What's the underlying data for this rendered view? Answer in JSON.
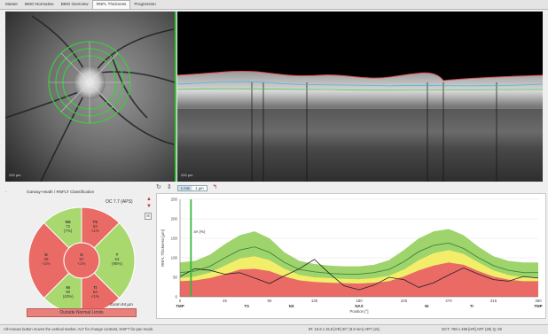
{
  "tabs": [
    {
      "label": "Master",
      "active": false
    },
    {
      "label": "BMO Normative",
      "active": false
    },
    {
      "label": "BMO Overview",
      "active": false
    },
    {
      "label": "RNFL Thickness",
      "active": true
    },
    {
      "label": "Progression",
      "active": false
    }
  ],
  "fundus": {
    "scale_label": "200 µm"
  },
  "oct": {
    "scale_label": "200 µm"
  },
  "toolbar": {
    "toggle_options": [
      "1 mm",
      "1 µm"
    ],
    "selected_toggle": "1 mm"
  },
  "classification": {
    "title": "Garway-Heath / RNFLT Classification",
    "scan_id": "OC 7.7 (APS)",
    "zoom_label": "Zoom 84 µm",
    "result_label": "Outside Normal Limits",
    "sectors": [
      {
        "key": "NS",
        "name": "NS",
        "value": "72",
        "pct": "(7%)",
        "status": "normal"
      },
      {
        "key": "TS",
        "name": "TS",
        "value": "53",
        "pct": "<1%",
        "status": "abnormal"
      },
      {
        "key": "T",
        "name": "T",
        "value": "63",
        "pct": "(95%)",
        "status": "normal"
      },
      {
        "key": "TI",
        "name": "TI",
        "value": "64",
        "pct": "<1%",
        "status": "abnormal"
      },
      {
        "key": "NI",
        "name": "NI",
        "value": "90",
        "pct": "(42%)",
        "status": "normal"
      },
      {
        "key": "N",
        "name": "N",
        "value": "39",
        "pct": "<1%",
        "status": "abnormal"
      },
      {
        "key": "G",
        "name": "G",
        "value": "57",
        "pct": "<1%",
        "status": "abnormal"
      }
    ]
  },
  "chart_data": {
    "type": "area",
    "ylabel": "RNFL Thickness [µm]",
    "xlabel": "Position [°]",
    "xlim": [
      0,
      360
    ],
    "ylim": [
      0,
      250
    ],
    "x_ticks": [
      0,
      45,
      90,
      135,
      180,
      225,
      270,
      315,
      360
    ],
    "y_ticks": [
      0,
      50,
      100,
      150,
      200,
      250
    ],
    "sector_labels": [
      {
        "label": "TMP",
        "x": 0
      },
      {
        "label": "TS",
        "x": 67
      },
      {
        "label": "NS",
        "x": 112
      },
      {
        "label": "NAS",
        "x": 180
      },
      {
        "label": "NI",
        "x": 248
      },
      {
        "label": "TI",
        "x": 293
      },
      {
        "label": "TMP",
        "x": 360
      }
    ],
    "cursor": {
      "x": 11,
      "label": "4A (%)"
    },
    "x": [
      0,
      15,
      30,
      45,
      60,
      75,
      90,
      105,
      120,
      135,
      150,
      165,
      180,
      195,
      210,
      225,
      240,
      255,
      270,
      285,
      300,
      315,
      330,
      345,
      360
    ],
    "band_red_upper": [
      40,
      42,
      48,
      58,
      70,
      72,
      66,
      52,
      42,
      38,
      36,
      35,
      34,
      36,
      40,
      52,
      68,
      80,
      88,
      82,
      66,
      52,
      44,
      40,
      40
    ],
    "band_yellow_upper": [
      48,
      52,
      62,
      80,
      98,
      104,
      94,
      72,
      56,
      50,
      48,
      46,
      45,
      48,
      54,
      70,
      94,
      112,
      120,
      110,
      88,
      68,
      56,
      50,
      48
    ],
    "band_green_upper": [
      88,
      92,
      108,
      135,
      158,
      168,
      150,
      114,
      92,
      84,
      80,
      78,
      78,
      82,
      94,
      120,
      150,
      168,
      174,
      158,
      128,
      104,
      92,
      88,
      88
    ],
    "series": [
      {
        "name": "Normal mean",
        "values": [
          62,
          66,
          78,
          100,
          120,
          128,
          114,
          88,
          70,
          64,
          60,
          58,
          58,
          62,
          70,
          90,
          116,
          132,
          138,
          124,
          100,
          80,
          68,
          62,
          62
        ]
      },
      {
        "name": "Patient",
        "values": [
          52,
          72,
          68,
          58,
          62,
          48,
          34,
          54,
          72,
          96,
          60,
          28,
          18,
          30,
          50,
          44,
          24,
          36,
          56,
          74,
          58,
          44,
          40,
          52,
          48
        ]
      }
    ],
    "colors": {
      "red": "#ea6a66",
      "yellow": "#f3ee6a",
      "green": "#9fd36b",
      "mean": "#3a8a3a",
      "patient": "#222222",
      "cursor": "#37b83a"
    }
  },
  "status": {
    "left": "Alt+mouse button moves the vertical marker, ALT for change contrast, SHIFT for pan mode.",
    "mid": "IR: 15.8 x 15.8 [HR] 30° (9.8 mm) ART (15)",
    "right": "OCT: 768 x 496 [HR] ART (29) Q: 28"
  }
}
